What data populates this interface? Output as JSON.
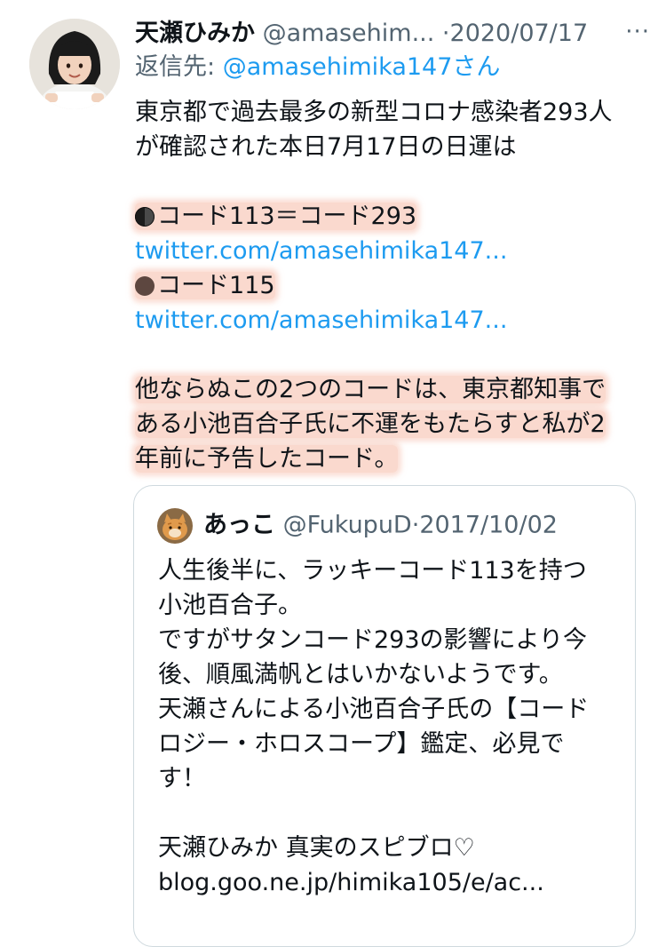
{
  "tweet": {
    "display_name": "天瀬ひみか",
    "handle": "@amasehim...",
    "separator": "·",
    "date": "2020/07/17",
    "more_icon": "···",
    "reply_prefix": "返信先: ",
    "reply_mention": "@amasehimika147さん",
    "body": {
      "line1": "東京都で過去最多の新型コロナ感染者293人",
      "line2": "が確認された本日7月17日の日運は",
      "code1_text": "コード113＝コード293",
      "link1": "twitter.com/amasehimika147...",
      "code2_text": "コード115",
      "link2": "twitter.com/amasehimika147...",
      "para1": "他ならぬこの2つのコードは、東京都知事で",
      "para2": "ある小池百合子氏に不運をもたらすと私が2",
      "para3": "年前に予告したコード。"
    }
  },
  "quote": {
    "display_name": "あっこ",
    "handle": "@FukupuD",
    "separator": "·",
    "date": "2017/10/02",
    "lines": [
      "人生後半に、ラッキーコード113を持つ",
      "小池百合子。",
      "ですがサタンコード293の影響により今",
      "後、順風満帆とはいかないようです。",
      "天瀬さんによる小池百合子氏の【コード",
      "ロジー・ホロスコープ】鑑定、必見で",
      "す！",
      "",
      "天瀬ひみか 真実のスピブロ♡",
      "blog.goo.ne.jp/himika105/e/ac..."
    ]
  },
  "icons": {
    "avatar": "user-avatar-photo",
    "quote_avatar": "cat-avatar-photo",
    "more": "more-options-icon",
    "moon1": "new-moon-icon",
    "moon2": "brown-circle-icon"
  },
  "colors": {
    "link": "#1d9bf0",
    "muted": "#536471",
    "text": "#0f1419",
    "highlight": "#f8c4b4",
    "border": "#cfd9de"
  }
}
